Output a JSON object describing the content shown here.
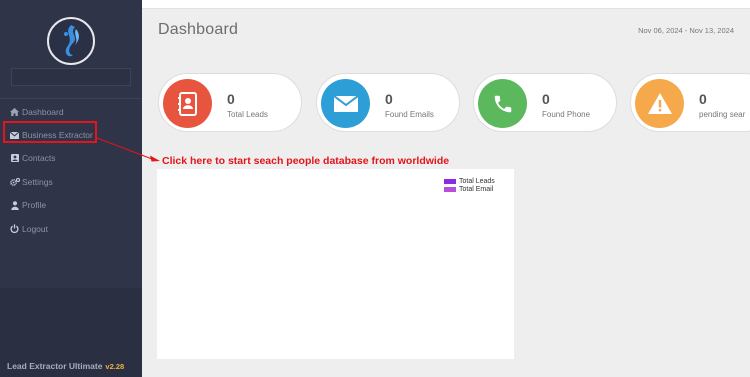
{
  "app": {
    "product_name": "Lead Extractor Ultimate",
    "version": "v2.28"
  },
  "sidebar": {
    "items": [
      {
        "label": "Dashboard",
        "icon": "home-icon"
      },
      {
        "label": "Business Extractor",
        "icon": "envelope-icon"
      },
      {
        "label": "Contacts",
        "icon": "contact-card-icon"
      },
      {
        "label": "Settings",
        "icon": "gears-icon"
      },
      {
        "label": "Profile",
        "icon": "user-icon"
      },
      {
        "label": "Logout",
        "icon": "power-icon"
      }
    ]
  },
  "header": {
    "title": "Dashboard",
    "date_range": "Nov 06, 2024 - Nov 13, 2024"
  },
  "stats": [
    {
      "value": "0",
      "label": "Total Leads",
      "color": "#e8553f",
      "icon": "contact-book-icon"
    },
    {
      "value": "0",
      "label": "Found Emails",
      "color": "#2e9fd6",
      "icon": "envelope-icon"
    },
    {
      "value": "0",
      "label": "Found Phone",
      "color": "#5cb85c",
      "icon": "phone-icon"
    },
    {
      "value": "0",
      "label": "pending sear",
      "color": "#f5a94a",
      "icon": "warning-icon"
    }
  ],
  "chart": {
    "legend": [
      {
        "label": "Total Leads",
        "color": "#8a2be2"
      },
      {
        "label": "Total Email",
        "color": "#b84fd6"
      }
    ]
  },
  "annotation": {
    "text": "Click here to start seach people database from worldwide",
    "color": "#e3141a"
  }
}
